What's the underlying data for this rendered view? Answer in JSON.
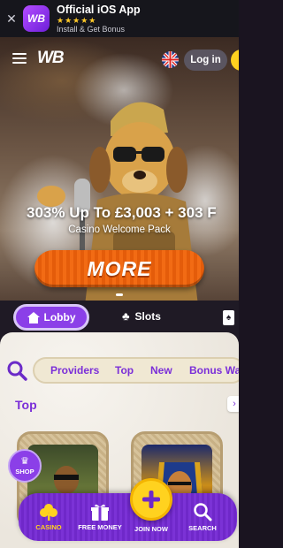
{
  "app_banner": {
    "title": "Official iOS App",
    "stars": "★★★★★",
    "subtitle": "Install & Get Bonus",
    "logo_text": "WB",
    "close_glyph": "✕"
  },
  "header": {
    "logo": "WB",
    "login_label": "Log in"
  },
  "hero": {
    "title": "303% Up To £3,003 + 303 F",
    "subtitle": "Casino Welcome Pack",
    "cta_label": "MORE"
  },
  "categories": [
    {
      "label": "Lobby",
      "icon": "home-icon",
      "active": true
    },
    {
      "label": "Slots",
      "icon": "clover-icon",
      "active": false
    },
    {
      "label": "",
      "icon": "cards-icon",
      "active": false
    }
  ],
  "filters": [
    "Providers",
    "Top",
    "New",
    "Bonus Wa"
  ],
  "section": {
    "title": "Top"
  },
  "shop": {
    "label": "SHOP"
  },
  "bottom_nav": [
    {
      "label": "CASINO",
      "icon": "clover-icon",
      "active": true
    },
    {
      "label": "FREE MONEY",
      "icon": "gift-icon",
      "active": false
    },
    {
      "label": "JOIN NOW",
      "icon": "plus-icon",
      "active": false
    },
    {
      "label": "SEARCH",
      "icon": "search-icon",
      "active": false
    }
  ],
  "colors": {
    "brand_purple": "#8b3fe8",
    "accent_orange": "#f26b14",
    "accent_yellow": "#ffd21f"
  }
}
